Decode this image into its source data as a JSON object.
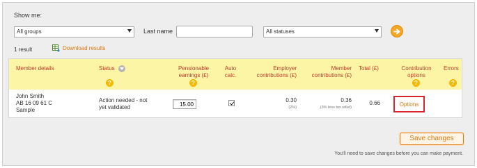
{
  "filters": {
    "show_me_label": "Show me:",
    "groups_selected": "All groups",
    "last_name_label": "Last name",
    "last_name_value": "",
    "status_selected": "All statuses"
  },
  "results": {
    "count_text": "1 result",
    "download_label": "Download results"
  },
  "table": {
    "headers": {
      "member_details": "Member details",
      "status": "Status",
      "pensionable_1": "Pensionable",
      "pensionable_2": "earnings (£)",
      "auto_1": "Auto",
      "auto_2": "calc.",
      "employer_1": "Employer",
      "employer_2": "contributions (£)",
      "member_1": "Member",
      "member_2": "contributions (£)",
      "total": "Total (£)",
      "contrib_1": "Contribution",
      "contrib_2": "options",
      "errors": "Errors"
    },
    "help_glyph": "?",
    "row": {
      "name": "John Smith",
      "ni": "AB 16 09 61 C",
      "group": "Sample",
      "status_1": "Action needed - not",
      "status_2": "yet validated",
      "pensionable_earnings": "15.00",
      "auto_calc_checked": true,
      "employer_value": "0.30",
      "employer_note": "(2%)",
      "member_value": "0.36",
      "member_note": "(3% less tax relief)",
      "total": "0.66",
      "options_label": "Options"
    }
  },
  "footer": {
    "save_label": "Save changes",
    "note": "You'll need to save changes before you can make payment."
  },
  "colors": {
    "accent_orange": "#e07a10",
    "header_yellow": "#fdf5a6",
    "header_text_red": "#c0392b",
    "help_yellow": "#f5b800",
    "highlight_red": "#d9232d"
  }
}
